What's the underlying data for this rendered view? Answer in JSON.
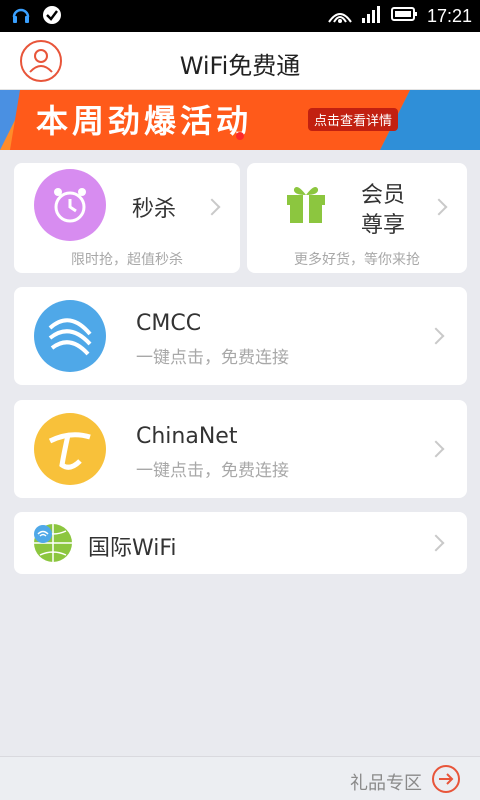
{
  "status": {
    "time": "17:21"
  },
  "header": {
    "title": "WiFi免费通"
  },
  "banner": {
    "headline": "本周劲爆活动",
    "cta": "点击查看详情"
  },
  "tiles": {
    "flash": {
      "title": "秒杀",
      "sub": "限时抢，超值秒杀"
    },
    "member": {
      "title_line1": "会员",
      "title_line2": "尊享",
      "sub": "更多好货，等你来抢"
    }
  },
  "networks": [
    {
      "name": "CMCC",
      "sub": "一键点击，免费连接"
    },
    {
      "name": "ChinaNet",
      "sub": "一键点击，免费连接"
    }
  ],
  "intl": {
    "label": "国际WiFi"
  },
  "footer": {
    "gift_label": "礼品专区"
  },
  "colors": {
    "accent": "#e8553a",
    "flash": "#d78cf0",
    "gift": "#8cc63f",
    "cmcc": "#4fa8e8",
    "chinanet": "#f8c13a"
  }
}
